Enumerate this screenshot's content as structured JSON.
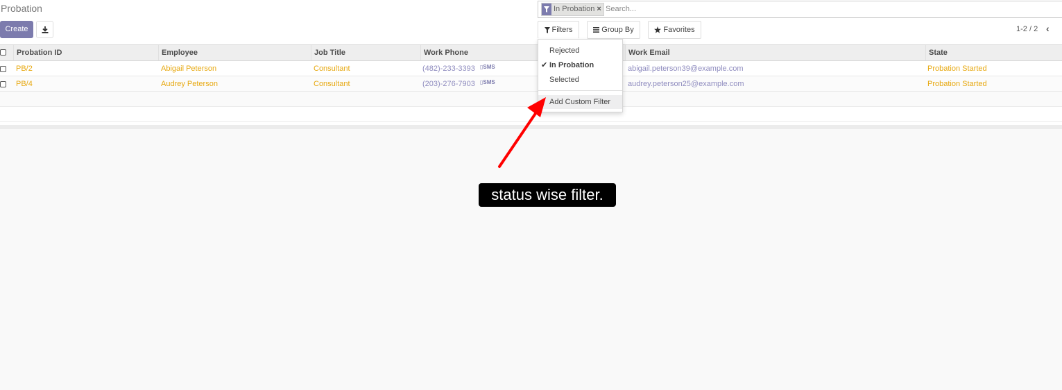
{
  "page": {
    "title": "Probation"
  },
  "toolbar": {
    "create_label": "Create",
    "download_icon": "download-icon"
  },
  "search": {
    "facet_label": "In Probation",
    "facet_icon": "filter-icon",
    "facet_remove": "×",
    "placeholder": "Search..."
  },
  "buttons": {
    "filters_label": "Filters",
    "groupby_label": "Group By",
    "favorites_label": "Favorites"
  },
  "pager": {
    "value": "1-2 / 2",
    "prev_icon": "chevron-left-icon"
  },
  "table": {
    "headers": [
      "Probation ID",
      "Employee",
      "Job Title",
      "Work Phone",
      "Work Email",
      "State"
    ],
    "sms_label": "SMS",
    "rows": [
      {
        "id": "PB/2",
        "employee": "Abigail Peterson",
        "job": "Consultant",
        "phone": "(482)-233-3393",
        "email": "abigail.peterson39@example.com",
        "state": "Probation Started"
      },
      {
        "id": "PB/4",
        "employee": "Audrey Peterson",
        "job": "Consultant",
        "phone": "(203)-276-7903",
        "email": "audrey.peterson25@example.com",
        "state": "Probation Started"
      }
    ]
  },
  "filters_menu": {
    "items": [
      {
        "label": "Rejected",
        "checked": false
      },
      {
        "label": "In Probation",
        "checked": true
      },
      {
        "label": "Selected",
        "checked": false
      }
    ],
    "custom_label": "Add Custom Filter"
  },
  "annotation": {
    "text": "status wise filter.",
    "arrow_color": "#ff0000"
  },
  "colors": {
    "primary": "#7c7bad",
    "link_yellow": "#e7a80f",
    "link_purple": "#8f8cbf"
  }
}
